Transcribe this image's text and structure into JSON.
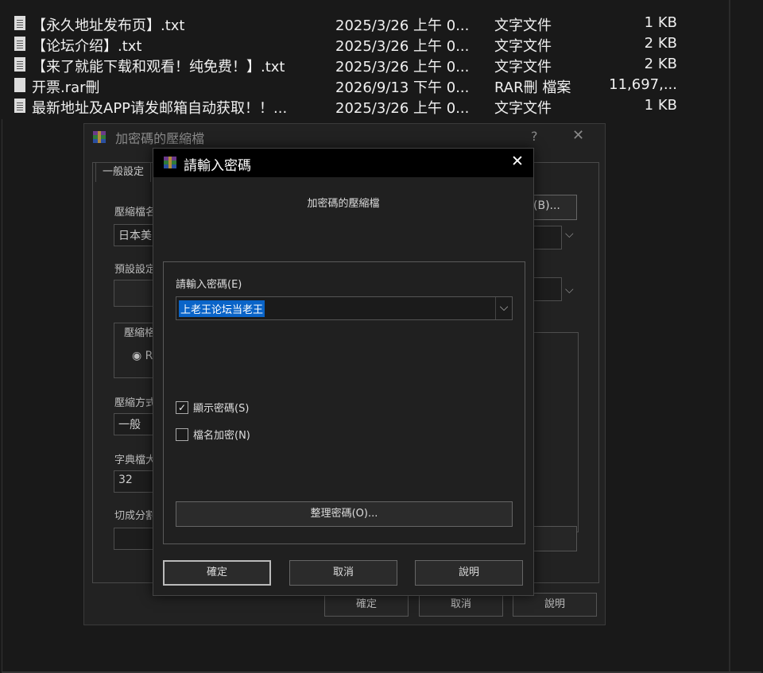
{
  "explorer": {
    "files": [
      {
        "name": "【永久地址发布页】.txt",
        "date": "2025/3/26 上午 0...",
        "type": "文字文件",
        "size": "1 KB",
        "icon": "txt-file-icon"
      },
      {
        "name": "【论坛介绍】.txt",
        "date": "2025/3/26 上午 0...",
        "type": "文字文件",
        "size": "2 KB",
        "icon": "txt-file-icon"
      },
      {
        "name": "【来了就能下载和观看！纯免费！】.txt",
        "date": "2025/3/26 上午 0...",
        "type": "文字文件",
        "size": "2 KB",
        "icon": "txt-file-icon"
      },
      {
        "name": "开票.rar刪",
        "date": "2026/9/13 下午 0...",
        "type": "RAR刪 檔案",
        "size": "11,697,...",
        "icon": "file-icon"
      },
      {
        "name": "最新地址及APP请发邮箱自动获取！！...",
        "date": "2025/3/26 上午 0...",
        "type": "文字文件",
        "size": "1 KB",
        "icon": "txt-file-icon"
      }
    ]
  },
  "back_dialog": {
    "title": "加密碼的壓縮檔",
    "help": "?",
    "close": "✕",
    "tab_general": "一般設定",
    "label_archive_name": "壓縮檔名",
    "archive_name_value": "日本美",
    "browse_button": "(B)...",
    "label_profile": "預設設定",
    "label_format": "壓縮格",
    "format_radio": "R",
    "label_method": "壓縮方式",
    "method_value": "一般",
    "label_dict": "字典檔大",
    "dict_value": "32",
    "label_split": "切成分割",
    "ok": "確定",
    "cancel": "取消",
    "help_button": "說明"
  },
  "password_dialog": {
    "title": "請輸入密碼",
    "close": "✕",
    "archive_name": "加密碼的壓縮檔",
    "password_label": "請輸入密碼(E)",
    "password_value": "上老王论坛当老王",
    "show_password_label": "顯示密碼(S)",
    "show_password_checked": true,
    "encrypt_names_label": "檔名加密(N)",
    "encrypt_names_checked": false,
    "manage_button": "整理密碼(O)...",
    "ok": "確定",
    "cancel": "取消",
    "help": "說明"
  },
  "colors": {
    "selection": "#0a64c8",
    "titlebar": "#000000",
    "background": "#191919"
  }
}
